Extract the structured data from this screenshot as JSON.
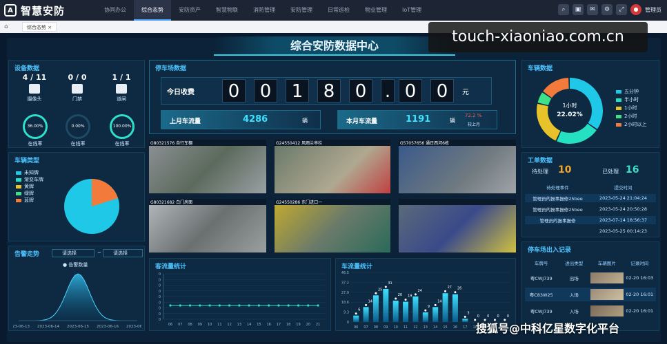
{
  "app": {
    "title": "智慧安防",
    "user": "管理员"
  },
  "nav": [
    "协同办公",
    "综合态势",
    "安防资产",
    "智慧物联",
    "消防管理",
    "安防管理",
    "日常巡检",
    "物业管理",
    "IoT管理"
  ],
  "nav_active": 1,
  "tab": {
    "label": "综合态势 ×"
  },
  "watermark_top": "touch-xiaoniao.com.cn",
  "watermark_bottom": "搜狐号@中科亿星数字化平台",
  "dashboard": {
    "title": "综合安防数据中心"
  },
  "device": {
    "title": "设备数据",
    "stats": [
      {
        "count": "4 / 11",
        "label": "摄像头"
      },
      {
        "count": "0 / 0",
        "label": "门禁"
      },
      {
        "count": "1 / 1",
        "label": "道闸"
      }
    ],
    "rings": [
      {
        "value": "36.00%",
        "label": "在线率",
        "fraction": 0.36
      },
      {
        "value": "0.00%",
        "label": "在线率",
        "fraction": 0
      },
      {
        "value": "100.00%",
        "label": "在线率",
        "fraction": 1
      }
    ]
  },
  "vehicle_type": {
    "title": "车辆类型",
    "legend": [
      {
        "label": "未知牌",
        "color": "#1ec8e6"
      },
      {
        "label": "渐变车牌",
        "color": "#26e0c2"
      },
      {
        "label": "黄牌",
        "color": "#e8c22a"
      },
      {
        "label": "绿牌",
        "color": "#3ee08a"
      },
      {
        "label": "蓝牌",
        "color": "#f27a3a"
      }
    ]
  },
  "parking": {
    "title": "停车场数据",
    "today_label": "今日收费",
    "digits": [
      "0",
      "0",
      "1",
      "8",
      "0",
      ".",
      "0",
      "0"
    ],
    "unit": "元",
    "last_month_label": "上月车流量",
    "last_month_value": "4286",
    "last_month_unit": "辆",
    "this_month_label": "本月车流量",
    "this_month_value": "1191",
    "this_month_unit": "辆",
    "ratio": "72.2 %",
    "ratio_label": "较上月"
  },
  "cameras": [
    {
      "label": "G80321576 自行车棚"
    },
    {
      "label": "G24550412 风雨兰亭栏"
    },
    {
      "label": "G57057656 通日西河6栋"
    },
    {
      "label": "G80321682 白门房面"
    },
    {
      "label": "G24550286 东门进口一"
    },
    {
      "label": ""
    }
  ],
  "alarm": {
    "title": "告警走势",
    "select1": "请选择",
    "select2": "请选择",
    "tilde": "~",
    "legend": "告警数量"
  },
  "vehicle_data": {
    "title": "车辆数据",
    "center_label": "1小时",
    "center_value": "22.02%",
    "legend": [
      {
        "label": "五分钟",
        "color": "#1ec8e6"
      },
      {
        "label": "半小时",
        "color": "#26e0c2"
      },
      {
        "label": "1小时",
        "color": "#e8c22a"
      },
      {
        "label": "2小时",
        "color": "#3ee08a"
      },
      {
        "label": "2小时以上",
        "color": "#f27a3a"
      }
    ],
    "slices": [
      0.35,
      0.22,
      0.22,
      0.06,
      0.15
    ]
  },
  "workorder": {
    "title": "工单数据",
    "pending_label": "待处理",
    "pending_value": "10",
    "done_label": "已处理",
    "done_value": "16",
    "headers": [
      "待处理事件",
      "提交时间"
    ],
    "rows": [
      [
        "管理员的报事报修25bee",
        "2023-05-24 21:04:24"
      ],
      [
        "管理员的报事报修25bee",
        "2023-05-24 20:50:28"
      ],
      [
        "管理员的报事报修",
        "2023-07-14 18:56:37"
      ],
      [
        "",
        "2023-05-25 00:14:23"
      ]
    ]
  },
  "passenger": {
    "title": "客流量统计"
  },
  "traffic": {
    "title": "车流量统计"
  },
  "parking_records": {
    "title": "停车场出入记录",
    "headers": [
      "车牌号",
      "进出类型",
      "车辆图片",
      "记录时间"
    ],
    "rows": [
      [
        "粤CWJ739",
        "出场",
        "02-20 16:03"
      ],
      [
        "粤C83W25",
        "入场",
        "02-20 16:01"
      ],
      [
        "粤CWJ739",
        "入场",
        "02-20 16:01"
      ]
    ]
  },
  "chart_data": [
    {
      "type": "area",
      "title": "告警走势",
      "series": [
        {
          "name": "告警数量"
        }
      ],
      "x": [
        "2023-06-13",
        "2023-06-14",
        "2023-06-15",
        "2023-06-16",
        "2023-06-17"
      ],
      "values": [
        0,
        0.2,
        1,
        0.2,
        0
      ]
    },
    {
      "type": "line",
      "title": "客流量统计",
      "x": [
        "06",
        "07",
        "08",
        "09",
        "10",
        "11",
        "12",
        "13",
        "14",
        "15",
        "16",
        "17",
        "18",
        "19",
        "20",
        "21"
      ],
      "values": [
        0,
        0,
        0,
        0,
        0,
        0,
        0,
        0,
        0,
        0,
        0,
        0,
        0,
        0,
        0,
        0
      ],
      "ylim": [
        0,
        1
      ]
    },
    {
      "type": "bar",
      "title": "车流量统计",
      "categories": [
        "06",
        "07",
        "08",
        "09",
        "10",
        "11",
        "12",
        "13",
        "14",
        "15",
        "16",
        "17",
        "18",
        "19",
        "20",
        "21"
      ],
      "values": [
        6,
        14,
        25,
        31,
        20,
        19,
        24,
        9,
        14,
        27,
        26,
        3,
        0,
        0,
        0,
        0
      ],
      "ylim": [
        0,
        46.5
      ],
      "y_ticks": [
        0,
        9.3,
        18.6,
        27.9,
        37.2,
        46.5
      ]
    }
  ]
}
